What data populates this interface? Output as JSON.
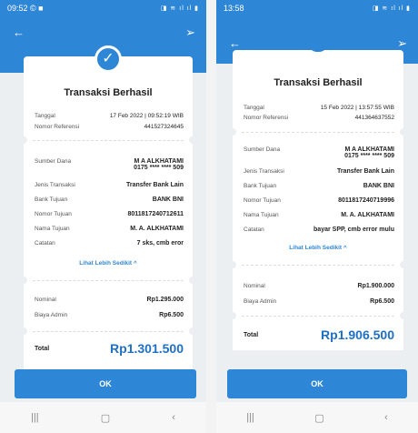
{
  "left": {
    "status": {
      "time": "09:52 © ■",
      "system": "◨ ≋ ıl ıl ▮"
    },
    "title": "Transaksi Berhasil",
    "tanggal": {
      "label": "Tanggal",
      "value": "17 Feb 2022 | 09:52:19 WIB"
    },
    "referensi": {
      "label": "Nomor Referensi",
      "value": "441527324645"
    },
    "sumber": {
      "label": "Sumber Dana",
      "name": "M A ALKHATAMI",
      "account": "0175 **** **** 509"
    },
    "jenis": {
      "label": "Jenis Transaksi",
      "value": "Transfer Bank Lain"
    },
    "bank": {
      "label": "Bank Tujuan",
      "value": "BANK BNI"
    },
    "nomor_tujuan": {
      "label": "Nomor Tujuan",
      "value": "8011817240712611"
    },
    "nama_tujuan": {
      "label": "Nama Tujuan",
      "value": "M. A. ALKHATAMI"
    },
    "catatan": {
      "label": "Catatan",
      "value": "7 sks, cmb eror"
    },
    "link": "Lihat Lebih Sedikit ^",
    "nominal": {
      "label": "Nominal",
      "value": "Rp1.295.000"
    },
    "biaya": {
      "label": "Biaya Admin",
      "value": "Rp6.500"
    },
    "total": {
      "label": "Total",
      "value": "Rp1.301.500"
    },
    "ok": "OK"
  },
  "right": {
    "status": {
      "time": "13:58",
      "system": "◨ ≋ ıl ıl ▮"
    },
    "title": "Transaksi Berhasil",
    "tanggal": {
      "label": "Tanggal",
      "value": "15 Feb 2022 | 13:57:55 WIB"
    },
    "referensi": {
      "label": "Nomor Referensi",
      "value": "441364637552"
    },
    "sumber": {
      "label": "Sumber Dana",
      "name": "M A ALKHATAMI",
      "account": "0175 **** **** 509"
    },
    "jenis": {
      "label": "Jenis Transaksi",
      "value": "Transfer Bank Lain"
    },
    "bank": {
      "label": "Bank Tujuan",
      "value": "BANK BNI"
    },
    "nomor_tujuan": {
      "label": "Nomor Tujuan",
      "value": "8011817240719996"
    },
    "nama_tujuan": {
      "label": "Nama Tujuan",
      "value": "M. A. ALKHATAMI"
    },
    "catatan": {
      "label": "Catatan",
      "value": "bayar SPP, cmb error mulu"
    },
    "link": "Lihat Lebih Sedikit ^",
    "nominal": {
      "label": "Nominal",
      "value": "Rp1.900.000"
    },
    "biaya": {
      "label": "Biaya Admin",
      "value": "Rp6.500"
    },
    "total": {
      "label": "Total",
      "value": "Rp1.906.500"
    },
    "ok": "OK"
  },
  "icons": {
    "back": "arrow-left-icon",
    "share": "send-icon",
    "check": "check-icon",
    "nav_recent": "recent-apps-icon",
    "nav_home": "home-icon",
    "nav_back": "nav-back-icon"
  },
  "colors": {
    "brand": "#2e86d6",
    "total": "#1f6fc2"
  }
}
